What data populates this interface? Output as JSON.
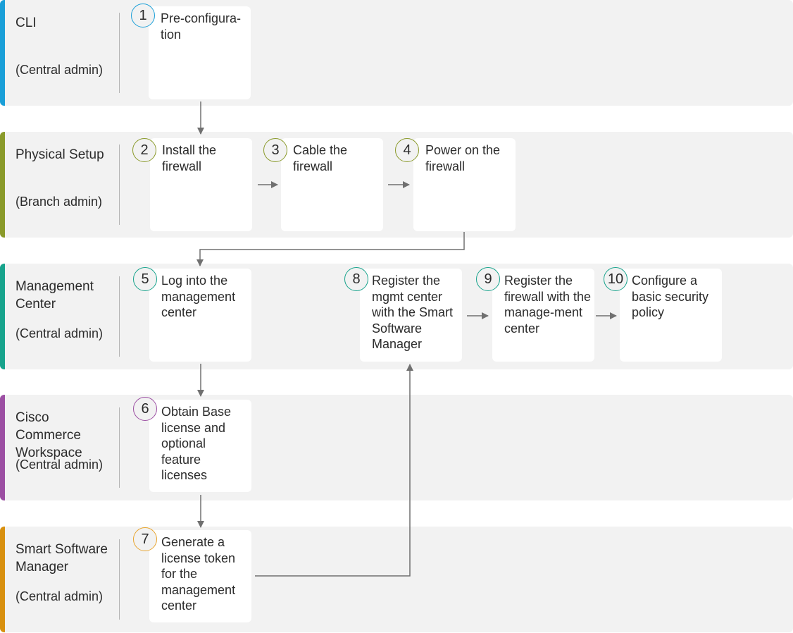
{
  "lanes": [
    {
      "title": "CLI",
      "role": "(Central admin)",
      "color": "#1a9fd8"
    },
    {
      "title": "Physical Setup",
      "role": "(Branch admin)",
      "color": "#8a9a2a"
    },
    {
      "title": "Management Center",
      "role": "(Central admin)",
      "color": "#17a38c"
    },
    {
      "title": "Cisco Commerce Workspace",
      "role": "(Central admin)",
      "color": "#9c4fa3"
    },
    {
      "title": "Smart Software Manager",
      "role": "(Central admin)",
      "color": "#d8900f"
    }
  ],
  "steps": [
    {
      "number": "1",
      "text": "Pre-configura-tion"
    },
    {
      "number": "2",
      "text": "Install the firewall"
    },
    {
      "number": "3",
      "text": "Cable the firewall"
    },
    {
      "number": "4",
      "text": "Power on the firewall"
    },
    {
      "number": "5",
      "text": "Log into the management center"
    },
    {
      "number": "6",
      "text": "Obtain Base license and optional feature licenses"
    },
    {
      "number": "7",
      "text": "Generate a license token for the management center"
    },
    {
      "number": "8",
      "text": "Register the mgmt center with the Smart Software Manager"
    },
    {
      "number": "9",
      "text": "Register the firewall with the manage-ment center"
    },
    {
      "number": "10",
      "text": "Configure a basic security policy"
    }
  ],
  "arrow_color": "#707070"
}
